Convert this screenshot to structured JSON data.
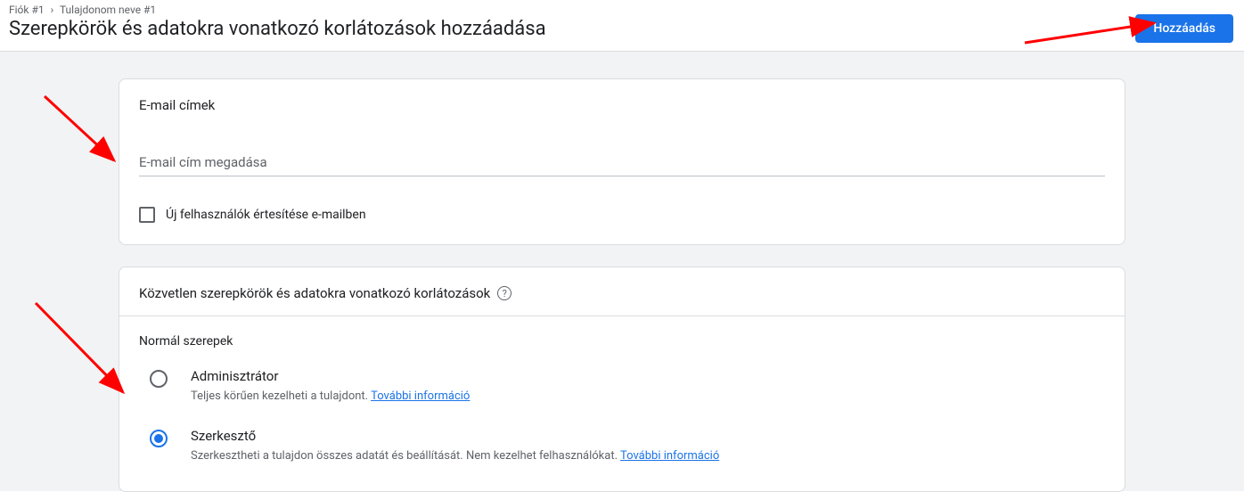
{
  "breadcrumb": {
    "account": "Fiók #1",
    "property": "Tulajdonom neve #1"
  },
  "page_title": "Szerepkörök és adatokra vonatkozó korlátozások hozzáadása",
  "add_button_label": "Hozzáadás",
  "email_section": {
    "title": "E-mail címek",
    "placeholder": "E-mail cím megadása",
    "notify_checkbox_label": "Új felhasználók értesítése e-mailben",
    "notify_checked": false
  },
  "roles_section": {
    "title": "Közvetlen szerepkörök és adatokra vonatkozó korlátozások",
    "subtitle": "Normál szerepek",
    "roles": [
      {
        "name": "Adminisztrátor",
        "description": "Teljes körűen kezelheti a tulajdont.",
        "more_info": "További információ",
        "selected": false
      },
      {
        "name": "Szerkesztő",
        "description": "Szerkesztheti a tulajdon összes adatát és beállítását. Nem kezelhet felhasználókat.",
        "more_info": "További információ",
        "selected": true
      }
    ]
  }
}
